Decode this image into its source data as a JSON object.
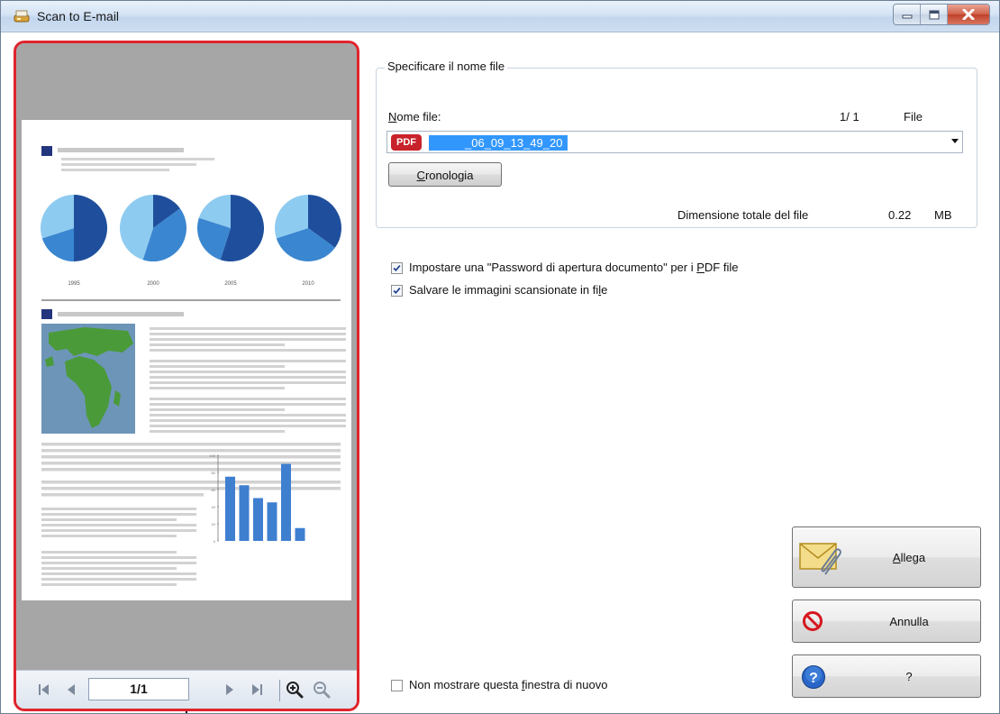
{
  "window": {
    "title": "Scan to E-mail",
    "controls": [
      "minimize",
      "maximize",
      "close"
    ]
  },
  "preview": {
    "page_indicator": "1/1",
    "nav_buttons": [
      "first-page",
      "previous-page",
      "next-page",
      "last-page",
      "zoom-in",
      "zoom-out"
    ],
    "document_thumbnail": {
      "pie_years": [
        "1995",
        "2000",
        "2005",
        "2010"
      ],
      "bar_axis_ticks": [
        "100",
        "80",
        "60",
        "40",
        "20",
        "0"
      ],
      "bar_values": [
        75,
        65,
        50,
        45,
        90,
        15
      ]
    }
  },
  "file_group": {
    "title": "Specificare il nome file",
    "filename_label": "Nome file:",
    "filename_label_accel": "N",
    "counter": "1/ 1",
    "counter_unit": "File",
    "file_type_badge": "PDF",
    "filename_value": "_06_09_13_49_20",
    "history_button": "Cronologia",
    "history_button_accel": "C",
    "total_size_label": "Dimensione totale del file",
    "total_size_value": "0.22",
    "total_size_unit": "MB"
  },
  "options": {
    "password_checkbox": {
      "label_before": "Impostare una \"Password di apertura documento\" per i ",
      "label_accel": "P",
      "label_after": "DF file",
      "checked": true
    },
    "save_images_checkbox": {
      "label_before": "Salvare le immagini scansionate in fi",
      "label_accel": "l",
      "label_after": "e",
      "checked": true
    },
    "dont_show_checkbox": {
      "label_before": "Non mostrare questa ",
      "label_accel": "f",
      "label_after": "inestra di nuovo",
      "checked": false
    }
  },
  "actions": {
    "attach_label_accel": "A",
    "attach_label_rest": "llega",
    "cancel_label": "Annulla",
    "help_label": "?"
  },
  "colors": {
    "highlight_border": "#e0242c",
    "selection": "#3297fd",
    "pdf_badge": "#c8222a",
    "pie_dark": "#1f4f9c",
    "pie_mid": "#3a86d0",
    "pie_light": "#8ecbf0",
    "bars": "#3f7fd0",
    "map_land": "#4b9a3a",
    "map_sea": "#6d95b8"
  }
}
